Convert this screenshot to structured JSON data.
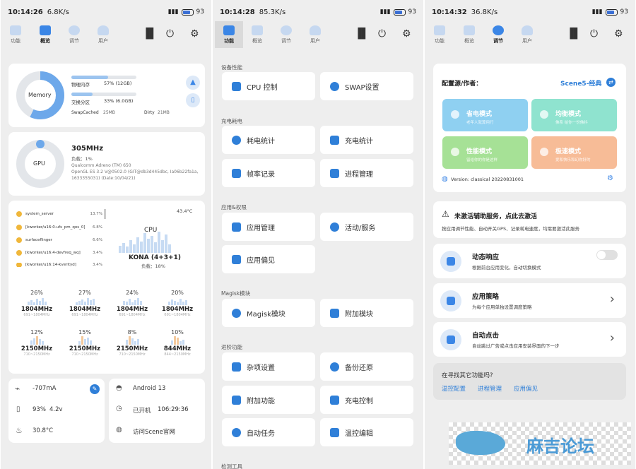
{
  "panels": [
    {
      "status": {
        "time": "10:14:26",
        "speed": "6.8K/s",
        "battery": "93"
      },
      "tabs": [
        {
          "label": "功能"
        },
        {
          "label": "概览"
        },
        {
          "label": "调节"
        },
        {
          "label": "用户"
        }
      ],
      "memory": {
        "ring_label": "Memory",
        "physical_label": "物理内存",
        "physical_value": "57% (12GB)",
        "physical_fraction": 0.57,
        "swap_label": "交换分区",
        "swap_value": "33% (6.0GB)",
        "swap_fraction": 0.33,
        "swapcached_label": "SwapCached",
        "swapcached_value": "25MB",
        "dirty_label": "Dirty",
        "dirty_value": "21MB"
      },
      "gpu": {
        "ring_label": "GPU",
        "freq": "305MHz",
        "load": "负载：1%",
        "renderer": "Qualcomm Adreno (TM) 650",
        "version1": "OpenGL ES 3.2 V@0502.0 (GIT@db3d445dbc, Ia06b22fa1a,",
        "version2": "1633355031) (Date:10/04/21)"
      },
      "cpu": {
        "temp": "43.4°C",
        "label": "CPU",
        "soc": "KONA (4+3+1)",
        "load": "负载：18%",
        "processes": [
          {
            "name": "system_server",
            "value": "13.7%"
          },
          {
            "name": "[kworker/u16:0-ufs_pm_qos_0]",
            "value": "6.8%"
          },
          {
            "name": "surfaceflinger",
            "value": "6.6%"
          },
          {
            "name": "[kworker/u16:4-devfreq_wq]",
            "value": "3.4%"
          },
          {
            "name": "[kworker/u16:14-kverityd]",
            "value": "3.4%"
          }
        ],
        "cores": [
          {
            "pct": "26%",
            "freq": "1804MHz",
            "range": "691~1804MHz"
          },
          {
            "pct": "27%",
            "freq": "1804MHz",
            "range": "691~1804MHz"
          },
          {
            "pct": "24%",
            "freq": "1804MHz",
            "range": "691~1804MHz"
          },
          {
            "pct": "20%",
            "freq": "1804MHz",
            "range": "691~1804MHz"
          },
          {
            "pct": "12%",
            "freq": "2150MHz",
            "range": "710~2150MHz"
          },
          {
            "pct": "15%",
            "freq": "2150MHz",
            "range": "710~2150MHz"
          },
          {
            "pct": "8%",
            "freq": "2150MHz",
            "range": "710~2150MHz"
          },
          {
            "pct": "10%",
            "freq": "844MHz",
            "range": "844~2150MHz"
          }
        ]
      },
      "battery": {
        "current": "-707mA",
        "level": "93%",
        "voltage": "4.2v",
        "temp": "30.8°C"
      },
      "system": {
        "android": "Android 13",
        "uptime_label": "已开机",
        "uptime": "106:29:36",
        "visit": "访问Scene官网"
      }
    },
    {
      "status": {
        "time": "10:14:28",
        "speed": "85.3K/s",
        "battery": "93"
      },
      "tabs": [
        {
          "label": "功能"
        },
        {
          "label": "概览"
        },
        {
          "label": "调节"
        },
        {
          "label": "用户"
        }
      ],
      "sections": [
        {
          "title": "设备性能",
          "items": [
            "CPU 控制",
            "SWAP设置"
          ]
        },
        {
          "title": "充电耗电",
          "items": [
            "耗电统计",
            "充电统计",
            "帧率记录",
            "进程管理"
          ]
        },
        {
          "title": "应用&权限",
          "items": [
            "应用管理",
            "活动/服务",
            "应用偏见"
          ]
        },
        {
          "title": "Magisk模块",
          "items": [
            "Magisk模块",
            "附加模块"
          ]
        },
        {
          "title": "进阶功能",
          "items": [
            "杂项设置",
            "备份还原",
            "附加功能",
            "充电控制",
            "自动任务",
            "温控编辑"
          ]
        },
        {
          "title": "检测工具",
          "items": []
        }
      ]
    },
    {
      "status": {
        "time": "10:14:32",
        "speed": "36.8K/s",
        "battery": "93"
      },
      "tabs": [
        {
          "label": "功能"
        },
        {
          "label": "概览"
        },
        {
          "label": "调节"
        },
        {
          "label": "用户"
        }
      ],
      "config": {
        "label": "配置源/作者：",
        "source": "Scene5-经典",
        "modes": [
          {
            "title": "省电模式",
            "desc": "老年人就算用行",
            "color": "#8fd0f1"
          },
          {
            "title": "均衡模式",
            "desc": "佛系 给你一份佛抖",
            "color": "#8fe3cf"
          },
          {
            "title": "性能模式",
            "desc": "留给你的你是这样",
            "color": "#a6e196"
          },
          {
            "title": "极速模式",
            "desc": "爱和快乐和幻你好的",
            "color": "#f7bc97"
          }
        ],
        "version": "Version: classical 20220831001"
      },
      "warning": {
        "title": "未激活辅助服务，点此去激活",
        "desc": "按应用调节性能、自动开关GPS、记录耗电速度，均需要激活此服务"
      },
      "rows": [
        {
          "title": "动态响应",
          "desc": "根据前台应用变化，自动切换模式",
          "toggle_on": false
        },
        {
          "title": "应用策略",
          "desc": "为每个应用单独设置调度策略"
        },
        {
          "title": "自动点击",
          "desc": "自动跳过广告或点击应用安装界面的下一步"
        }
      ],
      "more": {
        "title": "在寻找其它功能吗?",
        "links": [
          "温控配置",
          "进程管理",
          "应用偏见"
        ]
      },
      "watermark": "麻吉论坛"
    }
  ]
}
